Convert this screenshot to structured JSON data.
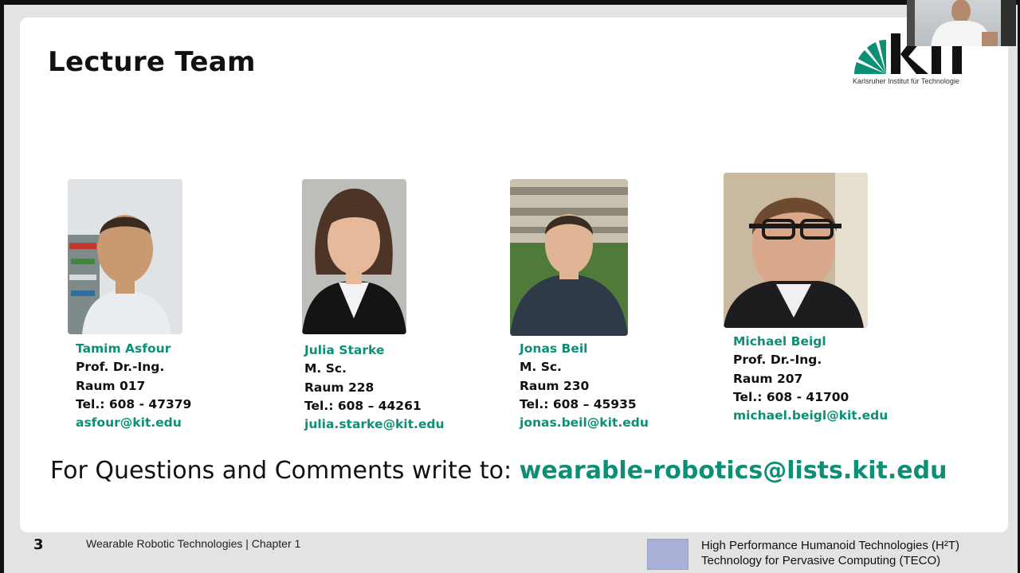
{
  "slide": {
    "title": "Lecture Team",
    "logo": {
      "wordmark": "KIT",
      "subtitle": "Karlsruher Institut für Technologie",
      "accent": "#0c8f75"
    },
    "team": [
      {
        "name": "Tamim Asfour",
        "title": "Prof. Dr.-Ing.",
        "room": "Raum 017",
        "tel": "Tel.: 608 - 47379",
        "email": "asfour@kit.edu"
      },
      {
        "name": "Julia Starke",
        "title": "M. Sc.",
        "room": "Raum 228",
        "tel": "Tel.: 608 – 44261",
        "email": "julia.starke@kit.edu"
      },
      {
        "name": "Jonas Beil",
        "title": "M. Sc.",
        "room": "Raum 230",
        "tel": "Tel.: 608 – 45935",
        "email": "jonas.beil@kit.edu"
      },
      {
        "name": "Michael Beigl",
        "title": "Prof. Dr.-Ing.",
        "room": "Raum 207",
        "tel": "Tel.: 608 - 41700",
        "email": "michael.beigl@kit.edu"
      }
    ],
    "questions": {
      "lead": "For Questions and Comments write to: ",
      "email": "wearable-robotics@lists.kit.edu"
    }
  },
  "footer": {
    "page_number": "3",
    "course": "Wearable Robotic Technologies | Chapter 1",
    "institute_line1": "High Performance Humanoid Technologies (H²T)",
    "institute_line2": "Technology for Pervasive Computing (TECO)"
  },
  "colors": {
    "accent": "#0c8f75",
    "slide_bg": "#ffffff",
    "frame_bg": "#e3e3e3"
  }
}
